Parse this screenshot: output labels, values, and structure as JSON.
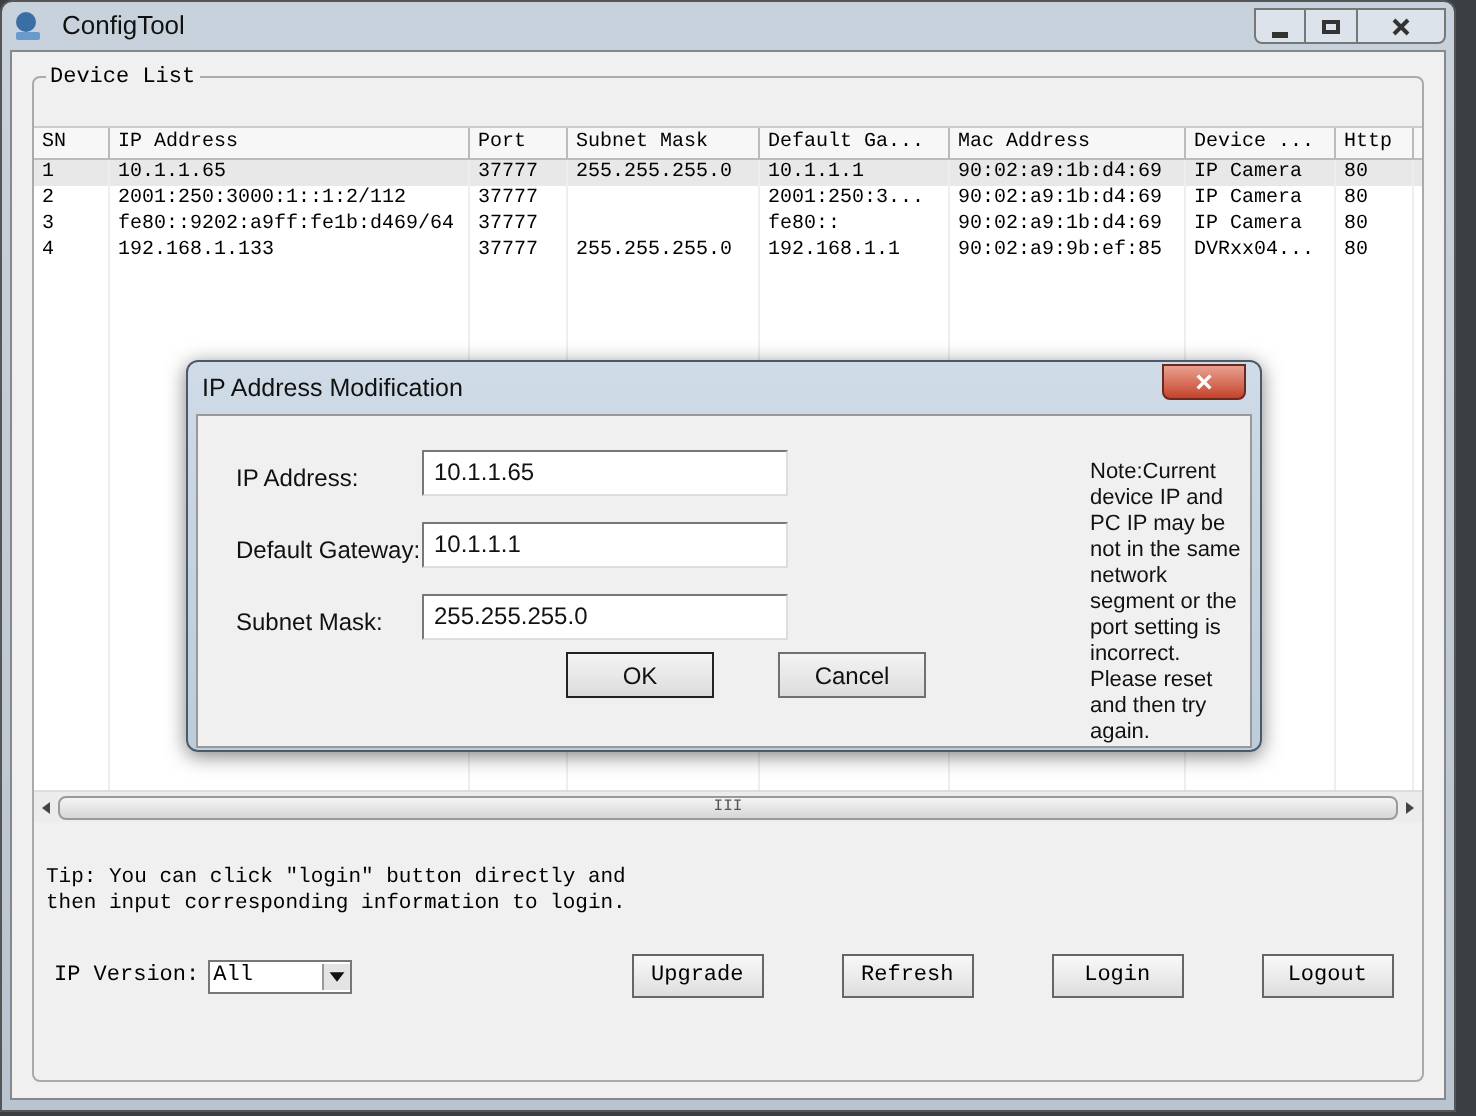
{
  "window": {
    "title": "ConfigTool"
  },
  "device_list": {
    "title": "Device List",
    "columns": [
      "SN",
      "IP Address",
      "Port",
      "Subnet Mask",
      "Default Ga...",
      "Mac Address",
      "Device ...",
      "Http"
    ],
    "rows": [
      {
        "cells": [
          "1",
          "10.1.1.65",
          "37777",
          "255.255.255.0",
          "10.1.1.1",
          "90:02:a9:1b:d4:69",
          "IP Camera",
          "80"
        ],
        "selected": true
      },
      {
        "cells": [
          "2",
          "2001:250:3000:1::1:2/112",
          "37777",
          "",
          "2001:250:3...",
          "90:02:a9:1b:d4:69",
          "IP Camera",
          "80"
        ],
        "selected": false
      },
      {
        "cells": [
          "3",
          "fe80::9202:a9ff:fe1b:d469/64",
          "37777",
          "",
          "fe80::",
          "90:02:a9:1b:d4:69",
          "IP Camera",
          "80"
        ],
        "selected": false
      },
      {
        "cells": [
          "4",
          "192.168.1.133",
          "37777",
          "255.255.255.0",
          "192.168.1.1",
          "90:02:a9:9b:ef:85",
          "DVRxx04...",
          "80"
        ],
        "selected": false
      }
    ],
    "scrollbar_grip": "III"
  },
  "tip": "Tip: You can click \"login\" button directly and then input corresponding information to login.",
  "ip_version": {
    "label": "IP Version:",
    "value": "All"
  },
  "buttons": [
    "Upgrade",
    "Refresh",
    "Login",
    "Logout"
  ],
  "dialog": {
    "title": "IP Address Modification",
    "close": "×",
    "fields": [
      {
        "label": "IP Address:",
        "value": "10.1.1.65"
      },
      {
        "label": "Default Gateway:",
        "value": "10.1.1.1"
      },
      {
        "label": "Subnet Mask:",
        "value": "255.255.255.0"
      }
    ],
    "note": "Note:Current device IP and PC IP may be not in the same network segment or the port setting is incorrect. Please reset and then try again.",
    "buttons": [
      {
        "label": "OK",
        "kind": "default"
      },
      {
        "label": "Cancel",
        "kind": "normal"
      }
    ]
  }
}
